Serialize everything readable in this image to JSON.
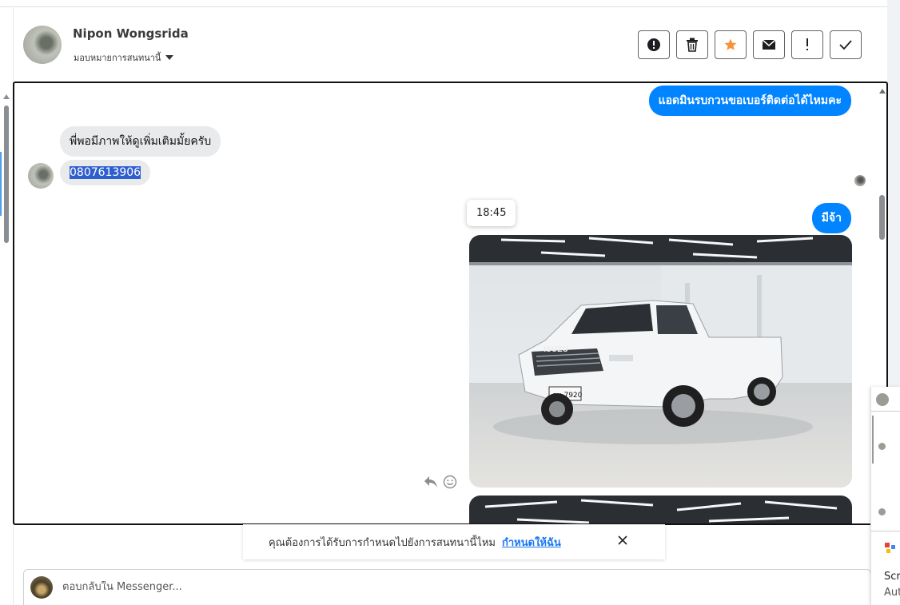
{
  "header": {
    "contact_name": "Nipon Wongsrida",
    "assign_label": "มอบหมายการสนทนานี้"
  },
  "actions": [
    {
      "name": "report-spam",
      "icon": "exclamation-circle-icon"
    },
    {
      "name": "delete",
      "icon": "trash-icon"
    },
    {
      "name": "star",
      "icon": "star-icon",
      "color": "#f7923a"
    },
    {
      "name": "mark-unread",
      "icon": "envelope-icon"
    },
    {
      "name": "follow-up",
      "icon": "exclamation-icon"
    },
    {
      "name": "mark-done",
      "icon": "check-icon"
    }
  ],
  "messages": {
    "out_1": "แอดมินรบกวนขอเบอร์ติดต่อได้ไหมคะ",
    "in_1": "พี่พอมีภาพให้ดูเพิ่มเติมมั้ยครับ",
    "in_2": "0807613906",
    "out_2": "มีจ้า",
    "timestamp_tooltip": "18:45",
    "photo_plate": "กน 7920",
    "photo_brand": "ISUZU"
  },
  "notice": {
    "text": "คุณต้องการได้รับการกำหนดไปยังการสนทนานี้ไหม",
    "link": "กำหนดให้ฉัน"
  },
  "reply": {
    "placeholder": "ตอบกลับใน Messenger..."
  },
  "side_preview": {
    "title": "Scre",
    "subtitle": "Aut"
  },
  "colors": {
    "outgoing_bubble": "#0084ff",
    "incoming_bubble": "#e9eaec",
    "selection": "#2f5fcf",
    "link": "#1877f2"
  }
}
